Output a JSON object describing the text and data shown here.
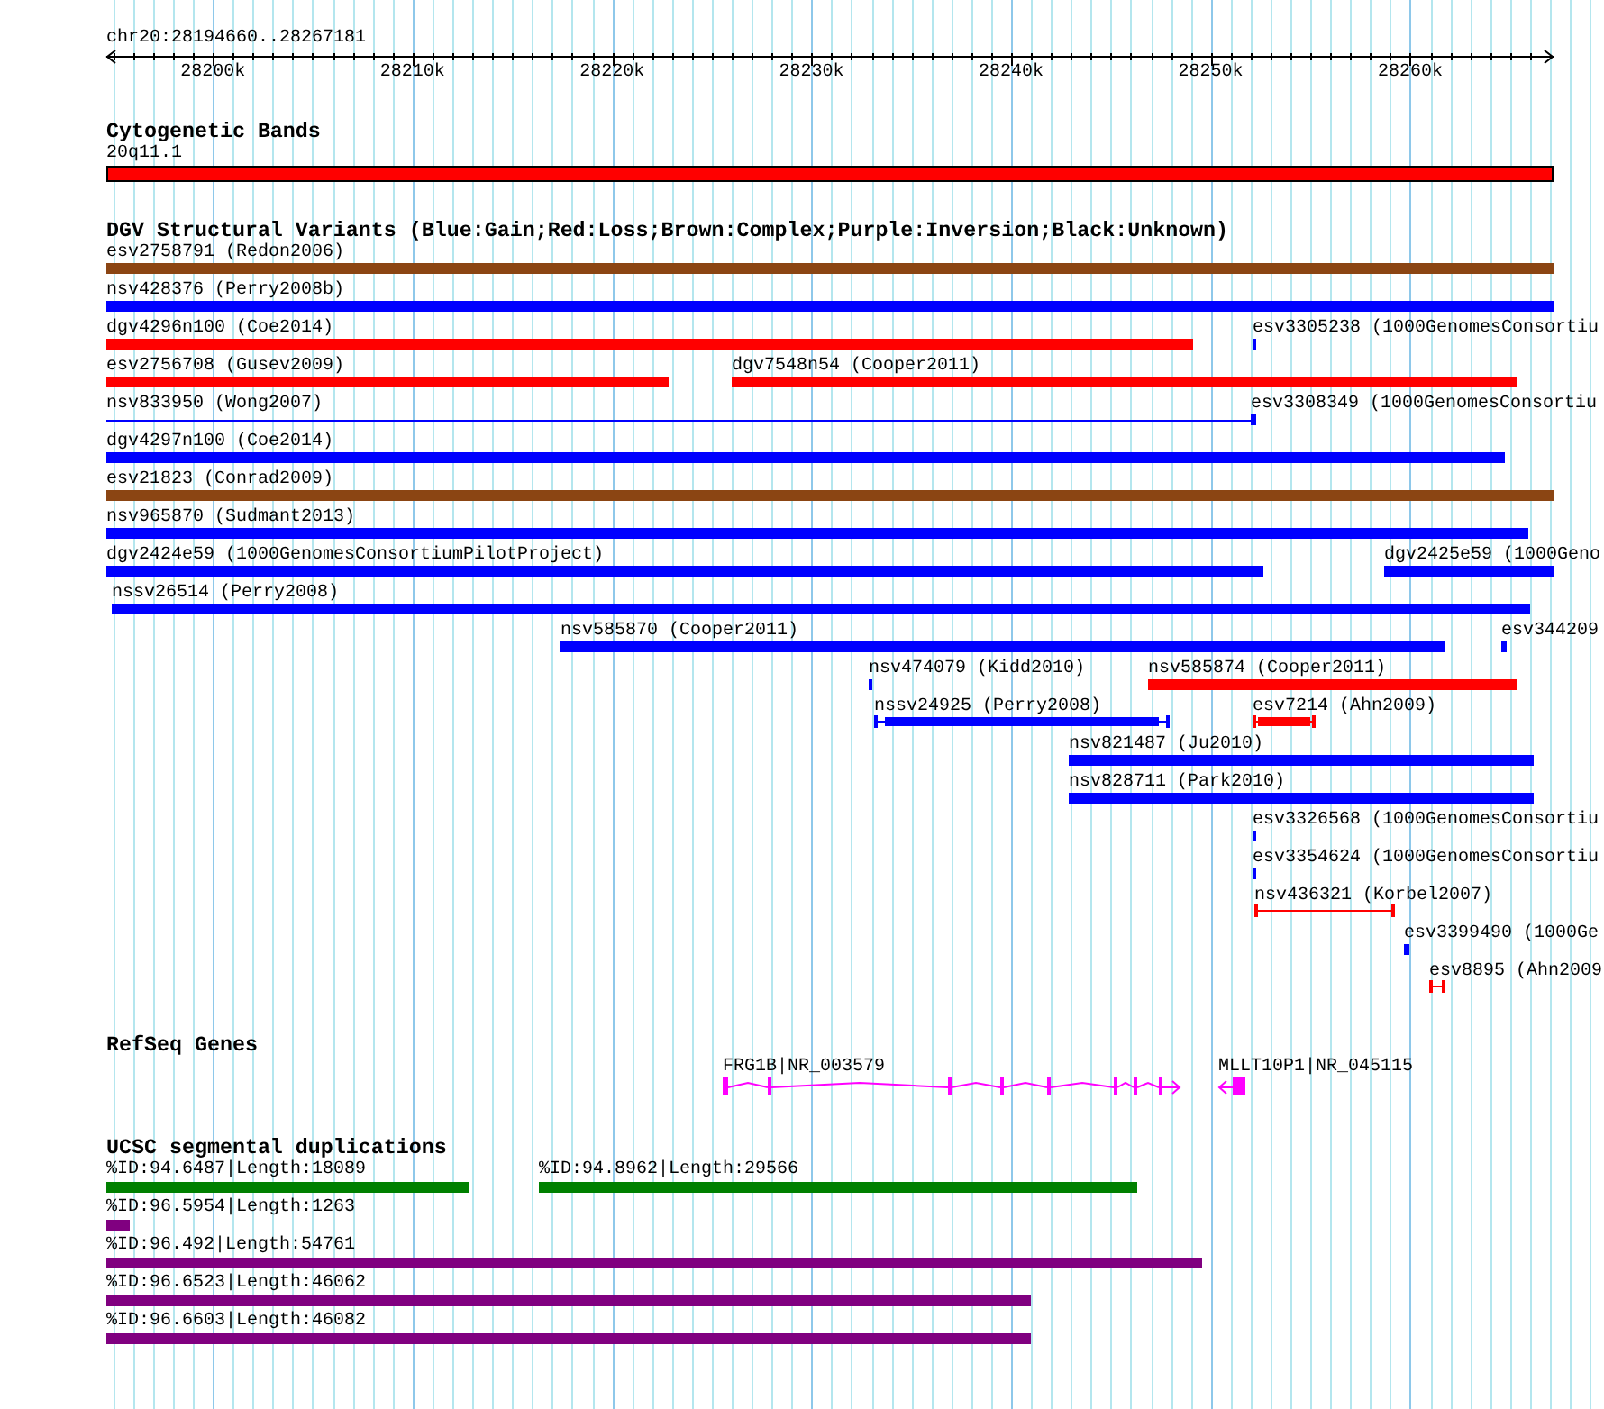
{
  "ruler": {
    "location": "chr20:28194660..28267181",
    "ticks": [
      "28200k",
      "28210k",
      "28220k",
      "28230k",
      "28240k",
      "28250k",
      "28260k"
    ]
  },
  "tracks": [
    {
      "kind": "cytoband",
      "title": "Cytogenetic Bands",
      "rows": [
        [
          {
            "label": "20q11.1"
          }
        ]
      ]
    },
    {
      "kind": "variants",
      "title": "DGV Structural Variants (Blue:Gain;Red:Loss;Brown:Complex;Purple:Inversion;Black:Unknown)",
      "rows": [
        [
          {
            "label": "esv2758791 (Redon2006)",
            "kind": "bar",
            "color": "#8b4513"
          }
        ],
        [
          {
            "label": "nsv428376 (Perry2008b)",
            "kind": "bar",
            "color": "#0000ff"
          }
        ],
        [
          {
            "label": "dgv4296n100 (Coe2014)",
            "kind": "bar",
            "color": "#ff0000"
          },
          {
            "label": "esv3305238 (1000GenomesConsortiu",
            "kind": "bar",
            "color": "#0000ff"
          }
        ],
        [
          {
            "label": "esv2756708 (Gusev2009)",
            "kind": "bar",
            "color": "#ff0000"
          },
          {
            "label": "dgv7548n54 (Cooper2011)",
            "kind": "bar",
            "color": "#ff0000"
          }
        ],
        [
          {
            "label": "nsv833950 (Wong2007)",
            "kind": "line",
            "color": "#0000ff"
          },
          {
            "label": "esv3308349 (1000GenomesConsortiu",
            "kind": "bar",
            "color": "#0000ff"
          }
        ],
        [
          {
            "label": "dgv4297n100 (Coe2014)",
            "kind": "bar",
            "color": "#0000ff"
          }
        ],
        [
          {
            "label": "esv21823 (Conrad2009)",
            "kind": "bar",
            "color": "#8b4513"
          }
        ],
        [
          {
            "label": "nsv965870 (Sudmant2013)",
            "kind": "bar",
            "color": "#0000ff"
          }
        ],
        [
          {
            "label": "dgv2424e59 (1000GenomesConsortiumPilotProject)",
            "kind": "bar",
            "color": "#0000ff"
          },
          {
            "label": "dgv2425e59 (1000Geno",
            "kind": "bar",
            "color": "#0000ff"
          }
        ],
        [
          {
            "label": "nssv26514 (Perry2008)",
            "kind": "bar",
            "color": "#0000ff"
          }
        ],
        [
          {
            "label": "nsv585870 (Cooper2011)",
            "kind": "bar",
            "color": "#0000ff"
          },
          {
            "label": "esv344209",
            "kind": "bar",
            "color": "#0000ff"
          }
        ],
        [
          {
            "label": "nsv474079 (Kidd2010)",
            "kind": "bar",
            "color": "#0000ff"
          },
          {
            "label": "nsv585874 (Cooper2011)",
            "kind": "bar",
            "color": "#ff0000"
          }
        ],
        [
          {
            "label": "nssv24925 (Perry2008)",
            "kind": "capped",
            "color": "#0000ff"
          },
          {
            "label": "esv7214 (Ahn2009)",
            "kind": "capped",
            "color": "#ff0000"
          }
        ],
        [
          {
            "label": "nsv821487 (Ju2010)",
            "kind": "bar",
            "color": "#0000ff"
          }
        ],
        [
          {
            "label": "nsv828711 (Park2010)",
            "kind": "bar",
            "color": "#0000ff"
          }
        ],
        [
          {
            "label": "esv3326568 (1000GenomesConsortiu",
            "kind": "bar",
            "color": "#0000ff"
          }
        ],
        [
          {
            "label": "esv3354624 (1000GenomesConsortiu",
            "kind": "bar",
            "color": "#0000ff"
          }
        ],
        [
          {
            "label": "nsv436321 (Korbel2007)",
            "kind": "capped-line",
            "color": "#ff0000"
          }
        ],
        [
          {
            "label": "esv3399490 (1000Ge",
            "kind": "bar",
            "color": "#0000ff"
          }
        ],
        [
          {
            "label": "esv8895 (Ahn2009",
            "kind": "capped-line",
            "color": "#ff0000"
          }
        ]
      ]
    },
    {
      "kind": "genes",
      "title": "RefSeq Genes",
      "rows": [
        [
          {
            "label": "FRG1B|NR_003579",
            "reverse": false
          },
          {
            "label": "MLLT10P1|NR_045115",
            "reverse": true
          }
        ]
      ]
    },
    {
      "kind": "duplications",
      "title": "UCSC segmental duplications",
      "rows": [
        [
          {
            "label": "%ID:94.6487|Length:18089",
            "color": "#008000"
          },
          {
            "label": "%ID:94.8962|Length:29566",
            "color": "#008000"
          }
        ],
        [
          {
            "label": "%ID:96.5954|Length:1263",
            "color": "#800080"
          }
        ],
        [
          {
            "label": "%ID:96.492|Length:54761",
            "color": "#800080"
          }
        ],
        [
          {
            "label": "%ID:96.6523|Length:46062",
            "color": "#800080"
          }
        ],
        [
          {
            "label": "%ID:96.6603|Length:46082",
            "color": "#800080"
          }
        ]
      ]
    }
  ]
}
